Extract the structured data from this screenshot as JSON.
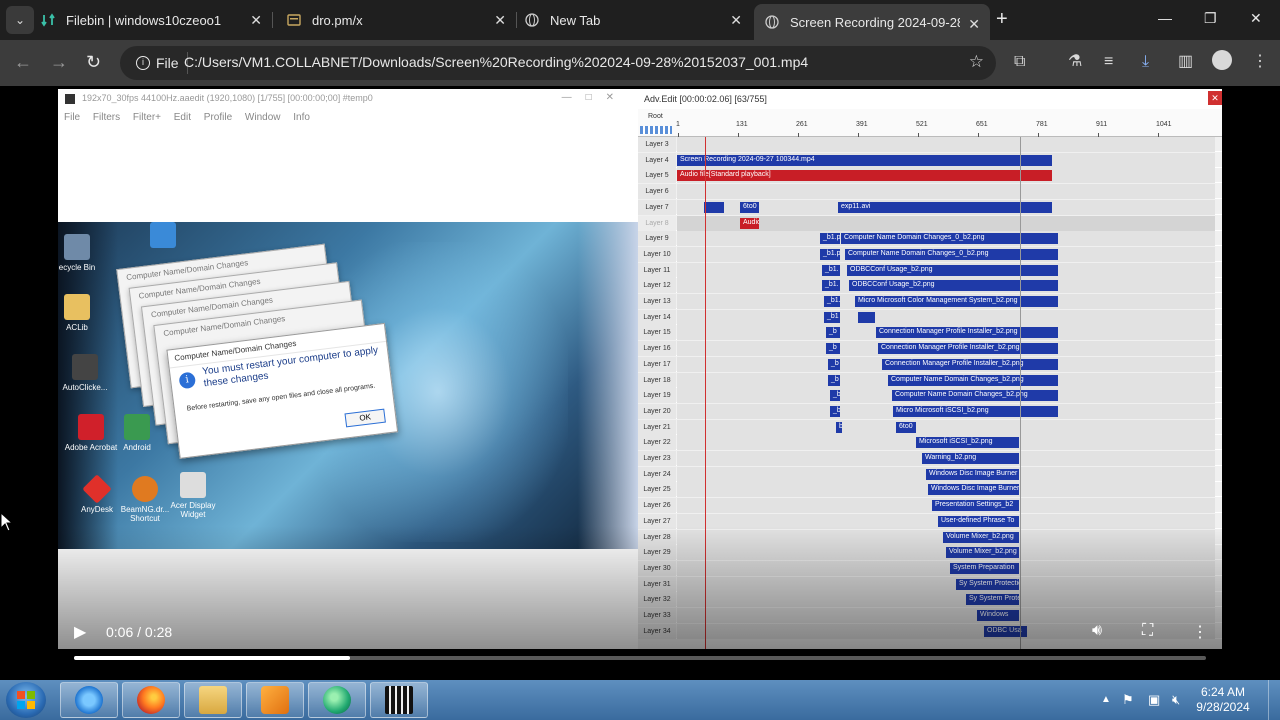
{
  "browser": {
    "tabs": [
      {
        "title": "Filebin | windows10czeoo1",
        "icon": "filebin-icon"
      },
      {
        "title": "dro.pm/x",
        "icon": "page-icon"
      },
      {
        "title": "New Tab",
        "icon": "globe-icon"
      },
      {
        "title": "Screen Recording 2024-09-28",
        "icon": "globe-icon",
        "active": true
      }
    ],
    "site_chip": "File",
    "url": "C:/Users/VM1.COLLABNET/Downloads/Screen%20Recording%202024-09-28%20152037_001.mp4"
  },
  "left_app": {
    "title": "192x70_30fps 44100Hz.aaedit (1920,1080)  [1/755] [00:00:00;00]  #temp0",
    "menu": [
      "File",
      "Filters",
      "Filter+",
      "Edit",
      "Profile",
      "Window",
      "Info"
    ],
    "desktop_icons": [
      "ecycle Bin",
      "ACLib",
      "AutoClicke...",
      "Adobe Acrobat",
      "Android",
      "AnyDesk",
      "BeamNG.dr... Shortcut",
      "Acer Display Widget"
    ],
    "dialog_title": "Computer Name/Domain Changes",
    "dialog_message": "You must restart your computer to apply these changes",
    "dialog_sub": "Before restarting, save any open files and close all programs.",
    "dialog_ok": "OK"
  },
  "timeline": {
    "title": "Adv.Edit [00:00:02.06] [63/755]",
    "root_label": "Root",
    "ruler": [
      "1",
      "131",
      "261",
      "391",
      "521",
      "651",
      "781",
      "911",
      "1041"
    ],
    "layers": [
      {
        "name": "Layer 3",
        "clips": []
      },
      {
        "name": "Layer 4",
        "clips": [
          {
            "label": "Screen Recording 2024-09-27 100344.mp4",
            "start": 0,
            "end": 375,
            "type": "video"
          }
        ]
      },
      {
        "name": "Layer 5",
        "clips": [
          {
            "label": "Audio file[Standard playback]",
            "start": 0,
            "end": 375,
            "type": "audio"
          }
        ]
      },
      {
        "name": "Layer 6",
        "clips": []
      },
      {
        "name": "Layer 7",
        "clips": [
          {
            "label": "",
            "start": 27,
            "end": 47,
            "type": "video"
          },
          {
            "label": "6to0",
            "start": 63,
            "end": 82,
            "type": "video"
          },
          {
            "label": "exp11.avi",
            "start": 161,
            "end": 375,
            "type": "video"
          }
        ]
      },
      {
        "name": "Layer 8",
        "dim": true,
        "clips": [
          {
            "label": "Audio",
            "start": 63,
            "end": 82,
            "type": "audio"
          }
        ]
      },
      {
        "name": "Layer 9",
        "clips": [
          {
            "label": "_b1.p",
            "start": 143,
            "end": 163,
            "type": "video"
          },
          {
            "label": "Computer Name Domain Changes_0_b2.png",
            "start": 164,
            "end": 381,
            "type": "video"
          }
        ]
      },
      {
        "name": "Layer 10",
        "clips": [
          {
            "label": "_b1.p",
            "start": 143,
            "end": 163,
            "type": "video"
          },
          {
            "label": "Computer Name Domain Changes_0_b2.png",
            "start": 168,
            "end": 381,
            "type": "video"
          }
        ]
      },
      {
        "name": "Layer 11",
        "clips": [
          {
            "label": "_b1.",
            "start": 145,
            "end": 163,
            "type": "video"
          },
          {
            "label": "ODBCConf Usage_b2.png",
            "start": 170,
            "end": 381,
            "type": "video"
          }
        ]
      },
      {
        "name": "Layer 12",
        "clips": [
          {
            "label": "_b1.",
            "start": 145,
            "end": 163,
            "type": "video"
          },
          {
            "label": "ODBCConf Usage_b2.png",
            "start": 172,
            "end": 381,
            "type": "video"
          }
        ]
      },
      {
        "name": "Layer 13",
        "clips": [
          {
            "label": "_b1.",
            "start": 147,
            "end": 163,
            "type": "video"
          },
          {
            "label": "Micro Microsoft Color Management System_b2.png",
            "start": 178,
            "end": 381,
            "type": "video"
          }
        ]
      },
      {
        "name": "Layer 14",
        "clips": [
          {
            "label": "_b1",
            "start": 147,
            "end": 163,
            "type": "video"
          },
          {
            "label": "",
            "start": 181,
            "end": 198,
            "type": "video"
          }
        ]
      },
      {
        "name": "Layer 15",
        "clips": [
          {
            "label": "_b",
            "start": 149,
            "end": 163,
            "type": "video"
          },
          {
            "label": "Connection Manager Profile Installer_b2.png",
            "start": 199,
            "end": 381,
            "type": "video"
          }
        ]
      },
      {
        "name": "Layer 16",
        "clips": [
          {
            "label": "_b",
            "start": 149,
            "end": 163,
            "type": "video"
          },
          {
            "label": "Connection Manager Profile Installer_b2.png",
            "start": 201,
            "end": 381,
            "type": "video"
          }
        ]
      },
      {
        "name": "Layer 17",
        "clips": [
          {
            "label": "_b",
            "start": 151,
            "end": 163,
            "type": "video"
          },
          {
            "label": "Connection Manager Profile Installer_b2.png",
            "start": 205,
            "end": 381,
            "type": "video"
          }
        ]
      },
      {
        "name": "Layer 18",
        "clips": [
          {
            "label": "_b",
            "start": 151,
            "end": 163,
            "type": "video"
          },
          {
            "label": "Computer Name Domain Changes_b2.png",
            "start": 211,
            "end": 381,
            "type": "video"
          }
        ]
      },
      {
        "name": "Layer 19",
        "clips": [
          {
            "label": "_b",
            "start": 153,
            "end": 163,
            "type": "video"
          },
          {
            "label": "Computer Name Domain Changes_b2.png",
            "start": 215,
            "end": 381,
            "type": "video"
          }
        ]
      },
      {
        "name": "Layer 20",
        "clips": [
          {
            "label": "_b",
            "start": 153,
            "end": 163,
            "type": "video"
          },
          {
            "label": "Micro Microsoft iSCSI_b2.png",
            "start": 216,
            "end": 381,
            "type": "video"
          }
        ]
      },
      {
        "name": "Layer 21",
        "clips": [
          {
            "label": "b",
            "start": 159,
            "end": 165,
            "type": "video"
          },
          {
            "label": "6to0",
            "start": 219,
            "end": 239,
            "type": "video"
          }
        ]
      },
      {
        "name": "Layer 22",
        "clips": [
          {
            "label": "Microsoft iSCSI_b2.png",
            "start": 239,
            "end": 342,
            "type": "video"
          }
        ]
      },
      {
        "name": "Layer 23",
        "clips": [
          {
            "label": "Warning_b2.png",
            "start": 245,
            "end": 342,
            "type": "video"
          }
        ]
      },
      {
        "name": "Layer 24",
        "clips": [
          {
            "label": "Windows Disc Image Burner",
            "start": 249,
            "end": 342,
            "type": "video"
          }
        ]
      },
      {
        "name": "Layer 25",
        "clips": [
          {
            "label": "Windows Disc Image Burner",
            "start": 251,
            "end": 342,
            "type": "video"
          }
        ]
      },
      {
        "name": "Layer 26",
        "clips": [
          {
            "label": "Presentation Settings_b2",
            "start": 255,
            "end": 342,
            "type": "video"
          }
        ]
      },
      {
        "name": "Layer 27",
        "clips": [
          {
            "label": "User-defined Phrase To",
            "start": 261,
            "end": 342,
            "type": "video"
          }
        ]
      },
      {
        "name": "Layer 28",
        "clips": [
          {
            "label": "Volume Mixer_b2.png",
            "start": 266,
            "end": 342,
            "type": "video"
          }
        ]
      },
      {
        "name": "Layer 29",
        "clips": [
          {
            "label": "Volume Mixer_b2.png",
            "start": 269,
            "end": 342,
            "type": "video"
          }
        ]
      },
      {
        "name": "Layer 30",
        "clips": [
          {
            "label": "System Preparation",
            "start": 273,
            "end": 342,
            "type": "video"
          }
        ]
      },
      {
        "name": "Layer 31",
        "clips": [
          {
            "label": "Sy System Protection",
            "start": 279,
            "end": 342,
            "type": "video"
          }
        ]
      },
      {
        "name": "Layer 32",
        "clips": [
          {
            "label": "Sy System Protection",
            "start": 289,
            "end": 342,
            "type": "video"
          }
        ]
      },
      {
        "name": "Layer 33",
        "clips": [
          {
            "label": "Windows",
            "start": 300,
            "end": 342,
            "type": "video"
          }
        ]
      },
      {
        "name": "Layer 34",
        "clips": [
          {
            "label": "ODBC Usa",
            "start": 307,
            "end": 350,
            "type": "video"
          }
        ]
      }
    ]
  },
  "player": {
    "time": "0:06 / 0:28",
    "progress": 0.244
  },
  "taskbar": {
    "apps": [
      "Internet Explorer",
      "Firefox",
      "File Explorer",
      "Media Player",
      "Browser",
      "Video Editor"
    ],
    "time": "6:24 AM",
    "date": "9/28/2024"
  }
}
